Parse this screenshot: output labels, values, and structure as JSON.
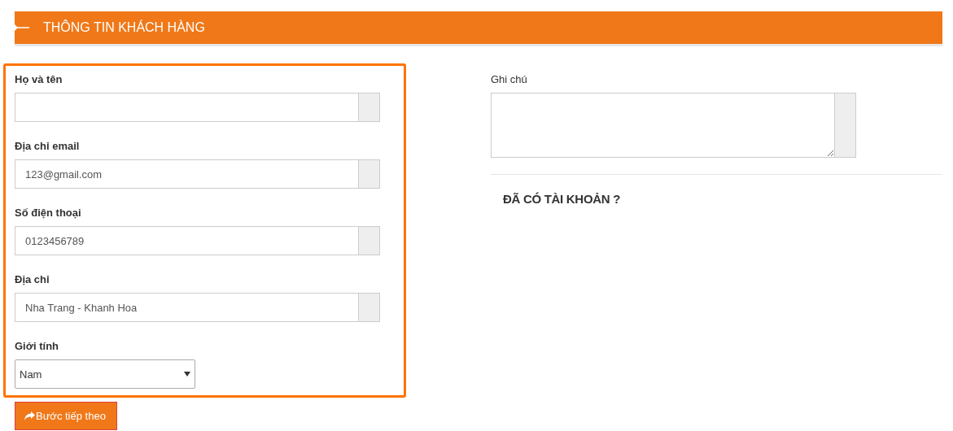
{
  "header": {
    "title": "THÔNG TIN KHÁCH HÀNG"
  },
  "customer_form": {
    "fields": [
      {
        "kind": "text",
        "label": "Họ và tên"
      },
      {
        "kind": "text",
        "label": "Địa chỉ email",
        "value": "123@gmail.com"
      },
      {
        "kind": "text",
        "label": "Số điện thoại",
        "value": "0123456789"
      },
      {
        "kind": "text",
        "label": "Địa chỉ",
        "value": "Nha Trang - Khanh Hoa"
      },
      {
        "kind": "select",
        "label": "Giới tính",
        "value": "Nam"
      }
    ]
  },
  "next_button": {
    "label": "Bước tiếp theo"
  },
  "note": {
    "label": "Ghi chú"
  },
  "account_heading": "ĐÃ CÓ TÀI KHOẢN ?"
}
